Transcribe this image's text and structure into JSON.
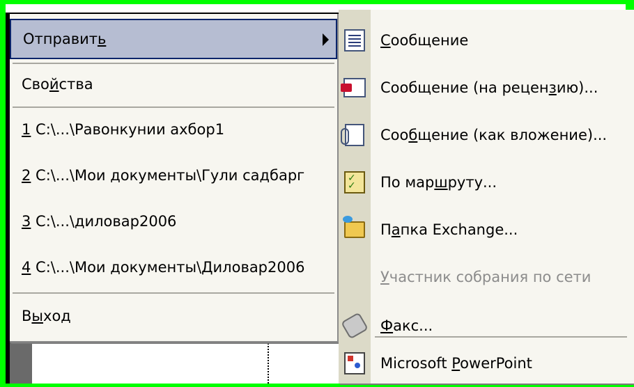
{
  "colors": {
    "screen_border": "#00ff00",
    "menu_background": "#f7f6f0",
    "selection": "#b6bdd2",
    "selection_border": "#0a246a",
    "icon_gutter": "#dcdac8",
    "disabled_text": "#8c8c8c"
  },
  "file_menu": {
    "items": [
      {
        "pre": "Отправит",
        "key": "ь",
        "post": "",
        "selected": true,
        "submenu": true
      },
      {
        "pre": "Сво",
        "key": "й",
        "post": "ства"
      },
      {
        "pre": "",
        "key": "1",
        "post": " C:\\...\\Равонкунии ахбор1"
      },
      {
        "pre": "",
        "key": "2",
        "post": " C:\\...\\Мои документы\\Гули садбарг"
      },
      {
        "pre": "",
        "key": "3",
        "post": " C:\\...\\диловар2006"
      },
      {
        "pre": "",
        "key": "4",
        "post": " C:\\...\\Мои документы\\Диловар2006"
      },
      {
        "pre": "В",
        "key": "ы",
        "post": "ход"
      }
    ]
  },
  "send_submenu": {
    "items": [
      {
        "icon": "message-icon",
        "pre": "",
        "key": "С",
        "post": "ообщение"
      },
      {
        "icon": "review-message-icon",
        "pre": "Сообщение (на рецен",
        "key": "з",
        "post": "ию)..."
      },
      {
        "icon": "attachment-message-icon",
        "pre": "Соо",
        "key": "б",
        "post": "щение (как вложение)..."
      },
      {
        "icon": "routing-slip-icon",
        "pre": "По мар",
        "key": "ш",
        "post": "руту..."
      },
      {
        "icon": "exchange-folder-icon",
        "pre": "П",
        "key": "а",
        "post": "пка Exchange..."
      },
      {
        "icon": "",
        "pre": "",
        "key": "У",
        "post": "частник собрания по сети",
        "disabled": true
      },
      {
        "icon": "fax-icon",
        "pre": "",
        "key": "Ф",
        "post": "акс..."
      },
      {
        "icon": "powerpoint-icon",
        "pre": "Microsoft ",
        "key": "P",
        "post": "owerPoint"
      }
    ]
  }
}
